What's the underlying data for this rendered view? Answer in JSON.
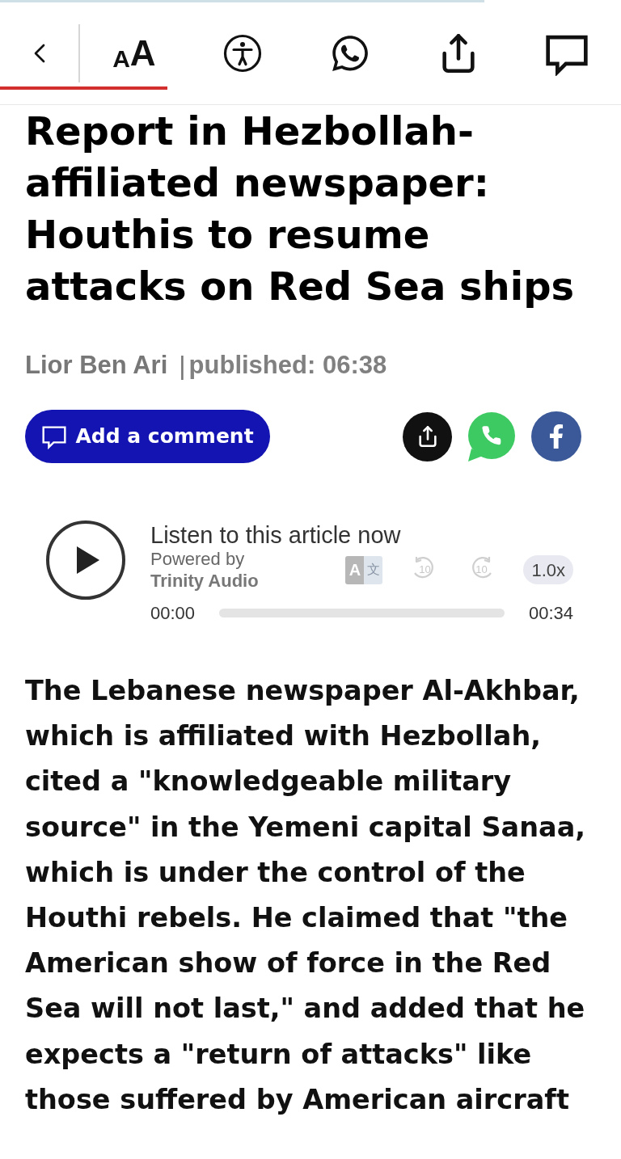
{
  "load_bar": {
    "level": 0.78
  },
  "toolbar": {
    "text_size": {
      "small": "A",
      "large": "A"
    },
    "reading_progress": {
      "level": 0.27
    }
  },
  "article": {
    "headline": "Report in Hezbollah-affiliated newspaper: Houthis to resume attacks on Red Sea ships",
    "author": "Lior Ben Ari",
    "separator": "|",
    "published": "published: 06:38",
    "comment_button": "Add a comment"
  },
  "audio_player": {
    "title": "Listen to this article now",
    "powered_by": "Powered by",
    "provider": "Trinity Audio",
    "translate": {
      "latin": "A",
      "chinese": "文"
    },
    "rewind": "10",
    "forward": "10",
    "speed": "1.0x",
    "elapsed": "00:00",
    "duration": "00:34"
  },
  "body": "The Lebanese newspaper Al-Akhbar, which is affiliated with Hezbollah, cited a \"knowledgeable military source\" in the Yemeni capital Sanaa, which is under the control of the Houthi rebels. He claimed that \"the American show of force in the Red Sea will not last,\" and added that he expects a \"return of attacks\" like those suffered by American aircraft"
}
